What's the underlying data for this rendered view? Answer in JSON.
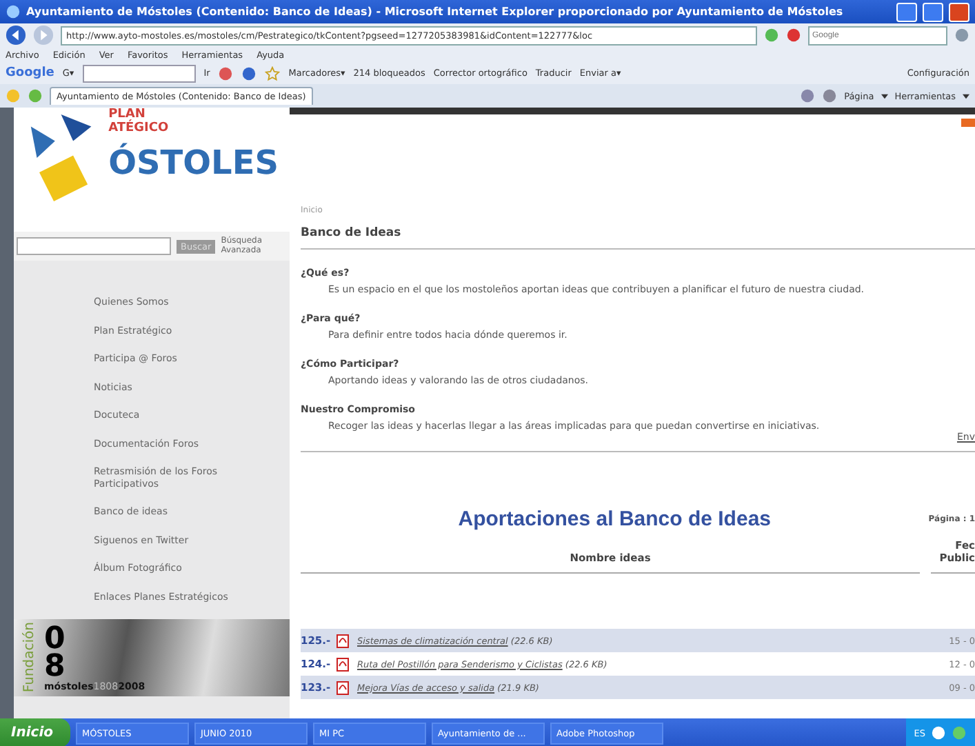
{
  "window": {
    "title": "Ayuntamiento de Móstoles (Contenido: Banco de Ideas) - Microsoft Internet Explorer proporcionado por Ayuntamiento de Móstoles"
  },
  "address_bar": {
    "url": "http://www.ayto-mostoles.es/mostoles/cm/Pestrategico/tkContent?pgseed=1277205383981&idContent=122777&loc",
    "search_placeholder": "Google"
  },
  "menu": [
    "Archivo",
    "Edición",
    "Ver",
    "Favoritos",
    "Herramientas",
    "Ayuda"
  ],
  "google_toolbar": {
    "logo": "Google",
    "search_label": "G▾",
    "go": "Ir",
    "bookmarks": "Marcadores▾",
    "blocked": "214 bloqueados",
    "spellcheck": "Corrector ortográfico",
    "translate": "Traducir",
    "send": "Enviar a▾",
    "settings": "Configuración"
  },
  "tab": {
    "title": "Ayuntamiento de Móstoles (Contenido: Banco de Ideas)"
  },
  "command_bar": [
    "Página",
    "Herramientas"
  ],
  "sidebar": {
    "logo_lines": [
      "PLAN",
      "ATÉGICO",
      "ÓSTOLES"
    ],
    "search_button": "Buscar",
    "advanced_search": "Búsqueda Avanzada",
    "items": [
      "Quienes Somos",
      "Plan Estratégico",
      "Participa @ Foros",
      "Noticias",
      "Docuteca",
      "Documentación Foros",
      "Retrasmisión de los Foros Participativos",
      "Banco de ideas",
      "Siguenos en Twitter",
      "Álbum Fotográfico",
      "Enlaces Planes Estratégicos"
    ],
    "banner": {
      "vertical": "Fundación",
      "digits": "08",
      "town": "móstoles",
      "years_a": "1808",
      "years_b": "2008"
    }
  },
  "breadcrumb": "Inicio",
  "page_title": "Banco de Ideas",
  "sections": [
    {
      "heading": "¿Qué es?",
      "text": "Es un espacio en el que los mostoleños aportan ideas que contribuyen a planificar el futuro de nuestra ciudad."
    },
    {
      "heading": "¿Para qué?",
      "text": "Para definir entre todos hacia dónde queremos ir."
    },
    {
      "heading": "¿Cómo Participar?",
      "text": "Aportando ideas y valorando las de otros ciudadanos."
    },
    {
      "heading": "Nuestro Compromiso",
      "text": "Recoger las ideas y hacerlas llegar a las áreas implicadas para que puedan convertirse en iniciativas."
    }
  ],
  "send_link": "Env",
  "list": {
    "title": "Aportaciones al Banco de Ideas",
    "page": "Página : 1",
    "columns": [
      "Nombre ideas",
      "Fec Public"
    ],
    "rows": [
      {
        "number": "125.-",
        "name": "Sistemas de climatización central",
        "size": "(22.6 KB)",
        "date": "15 - 0"
      },
      {
        "number": "124.-",
        "name": "Ruta del Postillón para Senderismo y Ciclistas",
        "size": "(22.6 KB)",
        "date": "12 - 0"
      },
      {
        "number": "123.-",
        "name": "Mejora Vías de acceso y salida",
        "size": "(21.9 KB)",
        "date": "09 - 0"
      }
    ]
  },
  "taskbar": {
    "start": "Inicio",
    "items": [
      "MÓSTOLES",
      "JUNIO 2010",
      "MI PC",
      "Ayuntamiento de ...",
      "Adobe Photoshop"
    ],
    "language": "ES"
  }
}
